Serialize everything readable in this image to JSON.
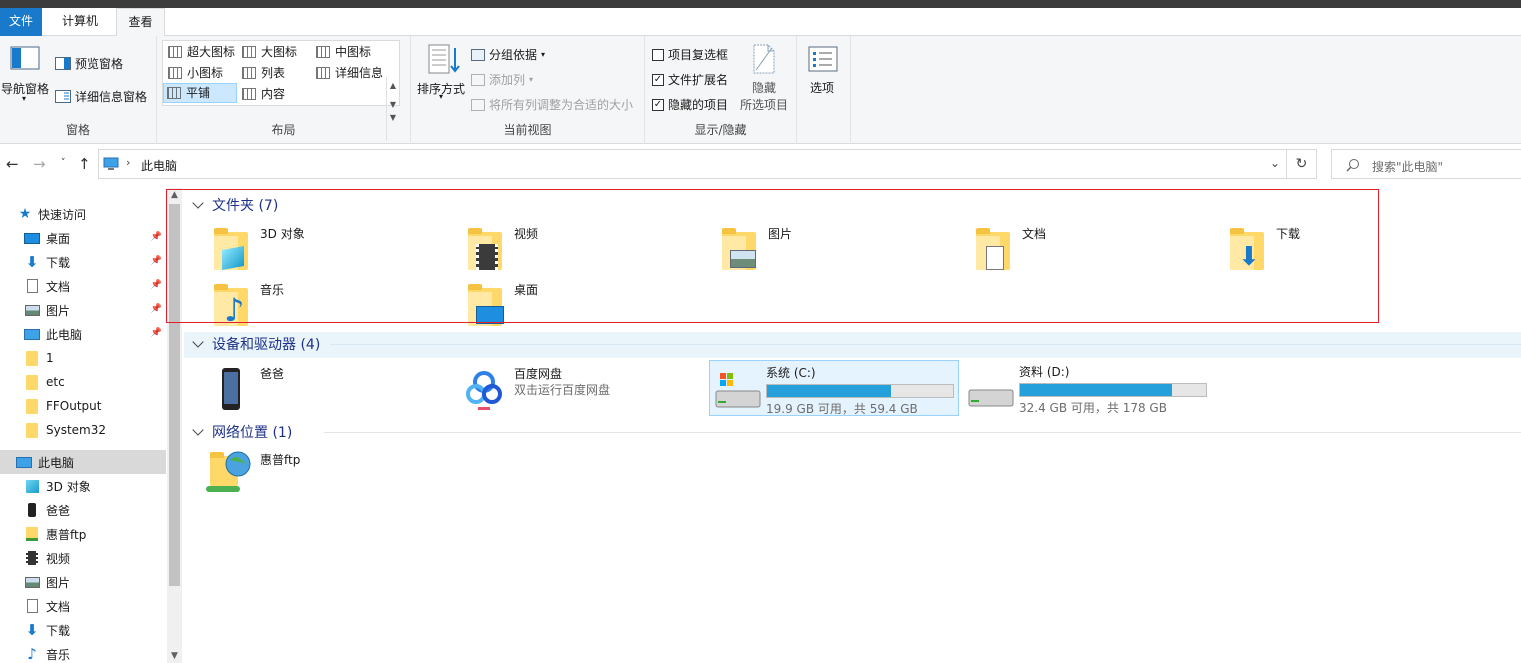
{
  "ribbon": {
    "tabs": [
      {
        "label": "文件"
      },
      {
        "label": "计算机"
      },
      {
        "label": "查看"
      }
    ],
    "groups": {
      "panes": {
        "label": "窗格",
        "nav_pane": "导航窗格",
        "preview_pane": "预览窗格",
        "details_pane": "详细信息窗格"
      },
      "layout": {
        "label": "布局",
        "items": [
          "超大图标",
          "大图标",
          "中图标",
          "小图标",
          "列表",
          "详细信息",
          "平铺",
          "内容"
        ],
        "selected": "平铺"
      },
      "current_view": {
        "label": "当前视图",
        "sort_by": "排序方式",
        "group_by": "分组依据",
        "add_column": "添加列",
        "fit_columns": "将所有列调整为合适的大小"
      },
      "show_hide": {
        "label": "显示/隐藏",
        "item_checkboxes": "项目复选框",
        "file_extensions": "文件扩展名",
        "hidden_items": "隐藏的项目",
        "hide_selected_line1": "隐藏",
        "hide_selected_line2": "所选项目",
        "checked": {
          "item_checkboxes": false,
          "file_extensions": true,
          "hidden_items": true
        }
      },
      "options": {
        "label": "选项"
      }
    }
  },
  "address": {
    "path": "此电脑",
    "search_placeholder": "搜索\"此电脑\""
  },
  "sidebar": {
    "quick_access": "快速访问",
    "quick_items": [
      "桌面",
      "下载",
      "文档",
      "图片",
      "此电脑",
      "1",
      "etc",
      "FFOutput",
      "System32"
    ],
    "this_pc": "此电脑",
    "pc_items": [
      "3D 对象",
      "爸爸",
      "惠普ftp",
      "视频",
      "图片",
      "文档",
      "下载",
      "音乐"
    ]
  },
  "content": {
    "folders_header": "文件夹 (7)",
    "folders": [
      "3D 对象",
      "视频",
      "图片",
      "文档",
      "下载",
      "音乐",
      "桌面"
    ],
    "devices_header": "设备和驱动器 (4)",
    "devices": [
      {
        "name": "爸爸",
        "sub": ""
      },
      {
        "name": "百度网盘",
        "sub": "双击运行百度网盘"
      }
    ],
    "drives": [
      {
        "name": "系统 (C:)",
        "space": "19.9 GB 可用，共 59.4 GB",
        "used_fraction": 0.665
      },
      {
        "name": "资料 (D:)",
        "space": "32.4 GB 可用，共 178 GB",
        "used_fraction": 0.818
      }
    ],
    "network_header": "网络位置 (1)",
    "network": [
      "惠普ftp"
    ]
  },
  "colors": {
    "accent": "#1979ca",
    "drive_fill": "#26a0da",
    "group_header": "#1e3287",
    "highlight_box": "#e0202a"
  }
}
